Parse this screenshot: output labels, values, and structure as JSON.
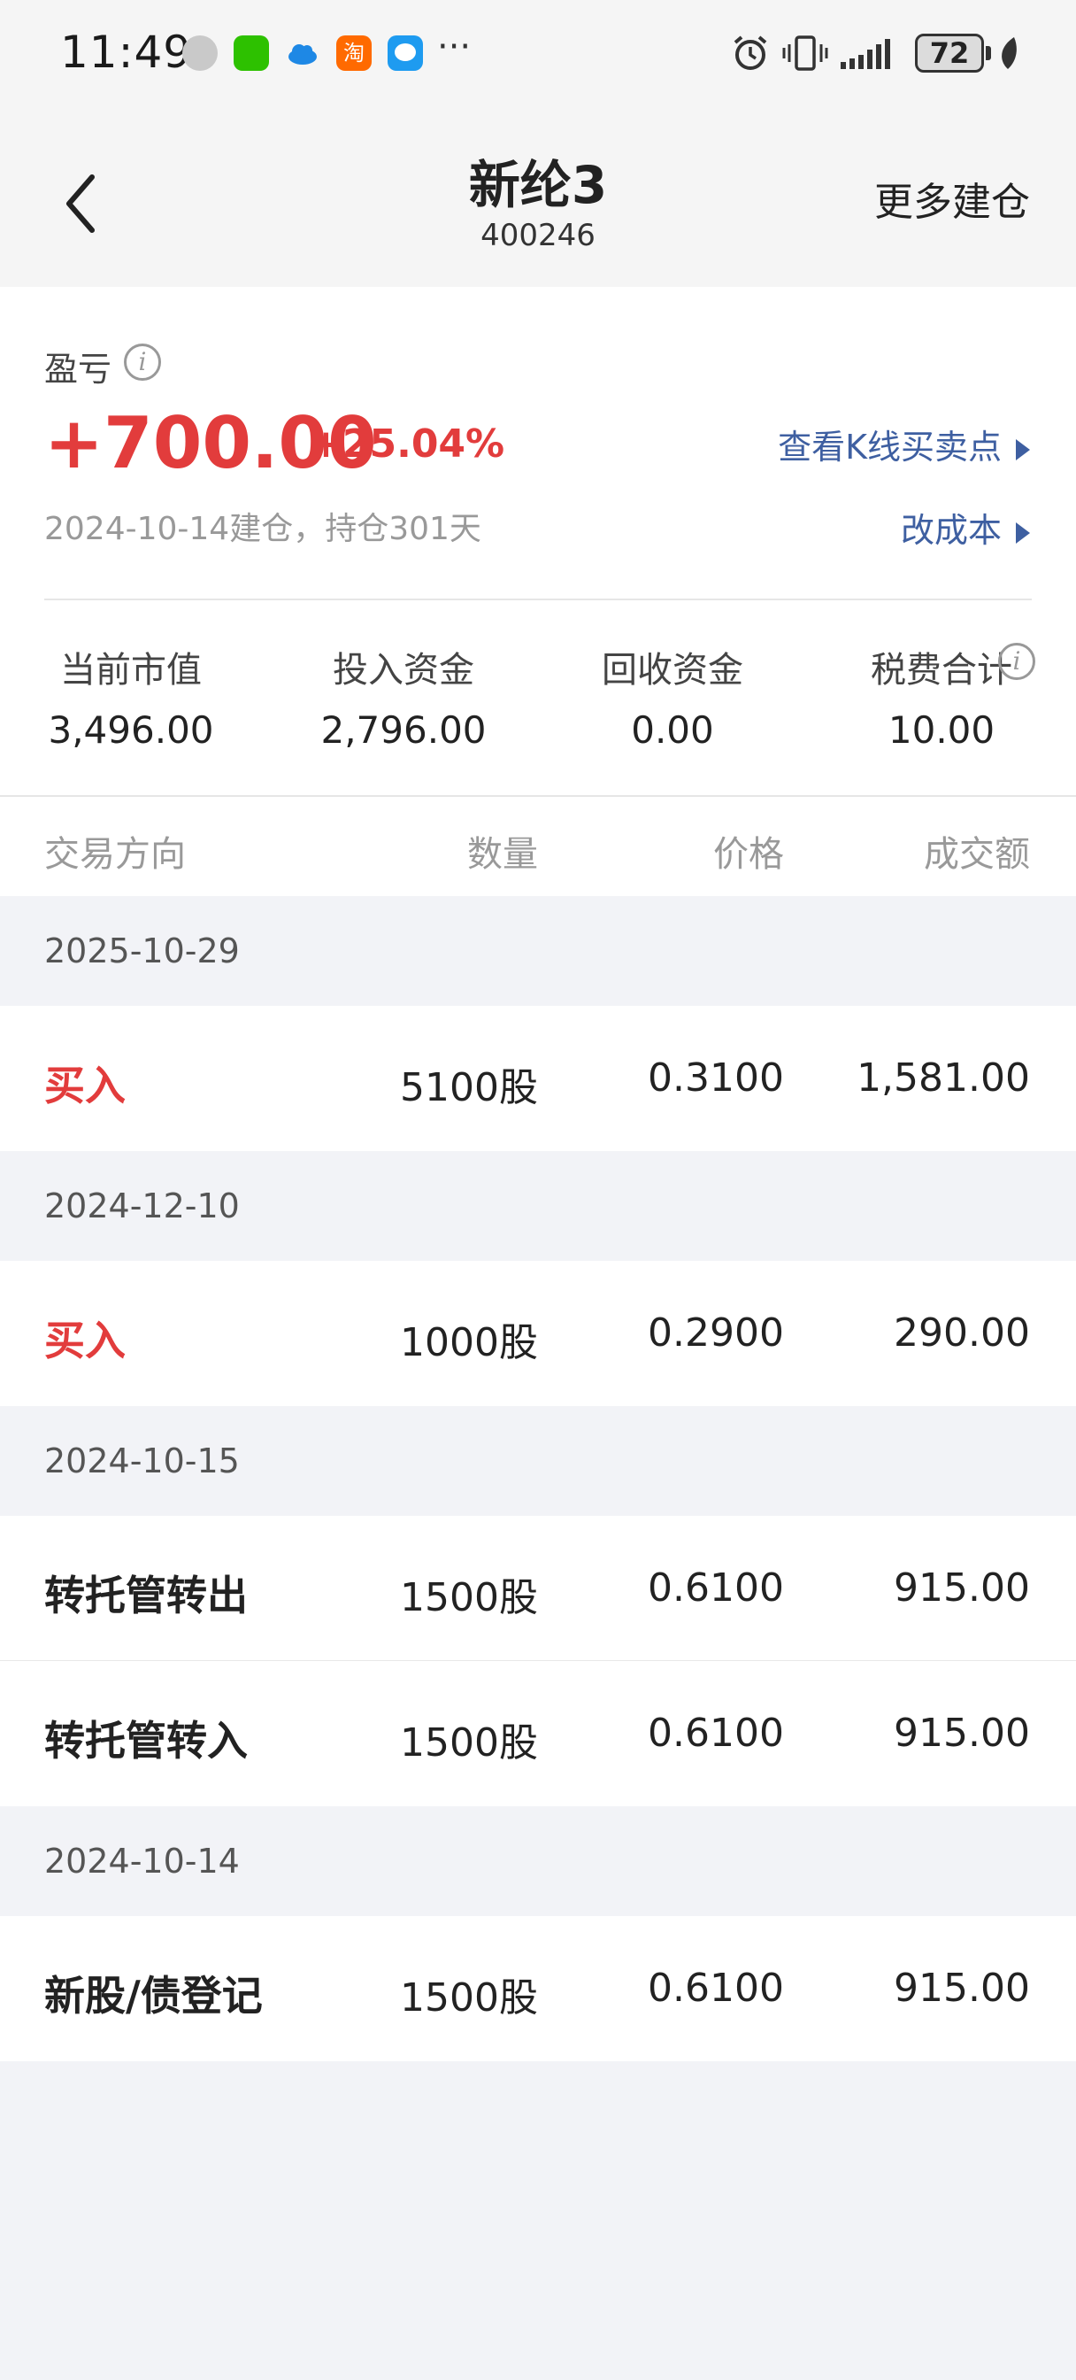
{
  "status_bar": {
    "time": "11:49",
    "more": "···",
    "battery": "72",
    "icons": [
      "avatar-app-icon",
      "wechat-icon",
      "cloud-icon",
      "taobao-icon",
      "message-icon",
      "alarm-icon",
      "vibrate-icon",
      "signal-icon",
      "battery-icon",
      "leaf-icon"
    ]
  },
  "header": {
    "title": "新纶3",
    "code": "400246",
    "more_label": "更多建仓"
  },
  "summary": {
    "pl_label": "盈亏",
    "pl_value": "+700.00",
    "pl_percent": "+25.04%",
    "kline_link": "查看K线买卖点",
    "opened_text": "2024-10-14建仓，持仓301天",
    "cost_link": "改成本",
    "metrics": [
      {
        "label": "当前市值",
        "value": "3,496.00"
      },
      {
        "label": "投入资金",
        "value": "2,796.00"
      },
      {
        "label": "回收资金",
        "value": "0.00"
      },
      {
        "label": "税费合计",
        "value": "10.00"
      }
    ],
    "accent_red": "#e23c3c",
    "link_blue": "#3e5fa1"
  },
  "table": {
    "headers": {
      "direction": "交易方向",
      "quantity": "数量",
      "price": "价格",
      "amount": "成交额"
    },
    "groups": [
      {
        "date": "2025-10-29",
        "rows": [
          {
            "direction": "买入",
            "quantity": "5100股",
            "price": "0.3100",
            "amount": "1,581.00"
          }
        ]
      },
      {
        "date": "2024-12-10",
        "rows": [
          {
            "direction": "买入",
            "quantity": "1000股",
            "price": "0.2900",
            "amount": "290.00"
          }
        ]
      },
      {
        "date": "2024-10-15",
        "rows": [
          {
            "direction": "转托管转出",
            "quantity": "1500股",
            "price": "0.6100",
            "amount": "915.00"
          },
          {
            "direction": "转托管转入",
            "quantity": "1500股",
            "price": "0.6100",
            "amount": "915.00"
          }
        ]
      },
      {
        "date": "2024-10-14",
        "rows": [
          {
            "direction": "新股/债登记",
            "quantity": "1500股",
            "price": "0.6100",
            "amount": "915.00"
          }
        ]
      }
    ]
  }
}
